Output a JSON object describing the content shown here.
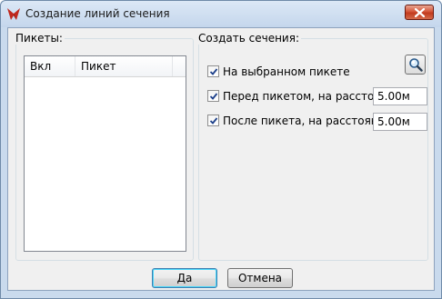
{
  "window": {
    "title": "Создание линий сечения",
    "app_icon": "app-logo-icon",
    "close_icon": "close-icon"
  },
  "pickets_group": {
    "label": "Пикеты:",
    "columns": [
      "Вкл",
      "Пикет",
      ""
    ],
    "rows": []
  },
  "sections_group": {
    "label": "Создать сечения:",
    "search_icon": "magnifier-icon",
    "options": [
      {
        "label": "На выбранном пикете",
        "checked": true
      },
      {
        "label": "Перед пикетом, на расстоянии",
        "checked": true,
        "value": "5.00м"
      },
      {
        "label": "После пикета, на расстоянии",
        "checked": true,
        "value": "5.00м"
      }
    ]
  },
  "buttons": {
    "ok": "Да",
    "cancel": "Отмена"
  }
}
